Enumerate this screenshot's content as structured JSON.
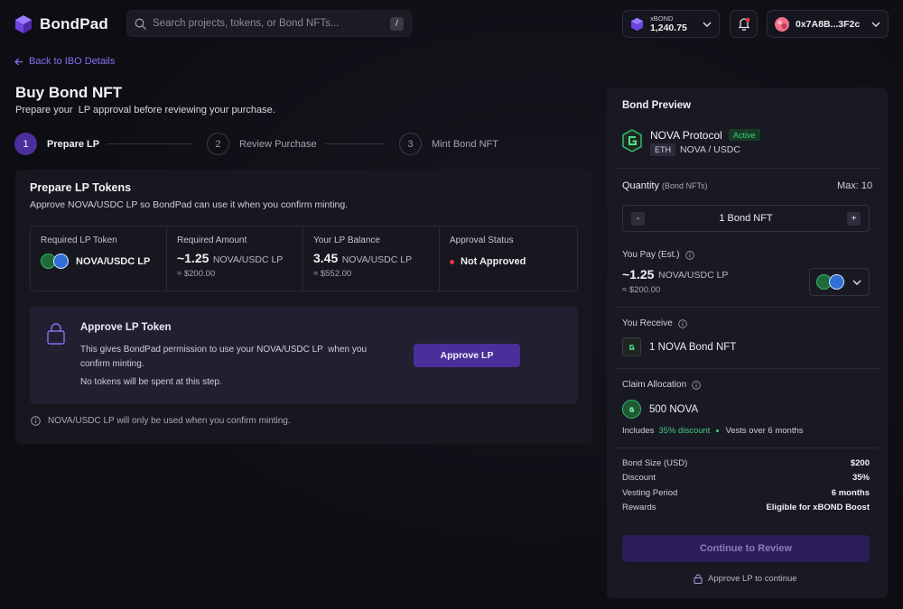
{
  "app": {
    "name": "BondPad"
  },
  "search": {
    "placeholder": "Search projects, tokens, or Bond NFTs...",
    "shortcut": "/"
  },
  "xbond": {
    "label": "xBOND",
    "value": "1,240.75"
  },
  "wallet": {
    "address": "0x7A8B...3F2c"
  },
  "nav": {
    "back_label": "Back to IBO Details"
  },
  "page": {
    "title": "Buy Bond NFT",
    "subtitle": "Prepare your  LP approval before reviewing your purchase."
  },
  "steps": [
    {
      "number": "1",
      "label": "Prepare LP",
      "active": true
    },
    {
      "number": "2",
      "label": "Review Purchase",
      "active": false
    },
    {
      "number": "3",
      "label": "Mint Bond NFT",
      "active": false
    }
  ],
  "prepare": {
    "title": "Prepare LP Tokens",
    "subtitle": "Approve NOVA/USDC LP so BondPad can use it when you confirm minting.",
    "required_token": {
      "label": "Required LP Token",
      "value": "NOVA/USDC LP"
    },
    "required_amount": {
      "label": "Required Amount",
      "value": "~1.25",
      "unit": "NOVA/USDC LP",
      "usd": "≈ $200.00"
    },
    "balance": {
      "label": "Your LP Balance",
      "value": "3.45",
      "unit": "NOVA/USDC LP",
      "usd": "≈ $552.00"
    },
    "approval": {
      "label": "Approval Status",
      "value": "Not Approved",
      "status_color": "#e03a3a"
    }
  },
  "approve_box": {
    "title": "Approve LP Token",
    "description": "This gives BondPad permission to use your NOVA/USDC LP  when you confirm minting.",
    "note": "No tokens will be spent at this step.",
    "button_label": "Approve LP"
  },
  "lp_note": "NOVA/USDC LP will only be used when you confirm minting.",
  "preview": {
    "title": "Bond Preview",
    "protocol": "NOVA Protocol",
    "status": "Active",
    "chain": "ETH",
    "pair": "NOVA / USDC",
    "quantity_label": "Quantity",
    "quantity_sub": "(Bond NFTs)",
    "max": "Max: 10",
    "quantity_value": "1 Bond NFT",
    "minus": "-",
    "plus": "+",
    "pay_label": "You Pay (Est.)",
    "pay_amount": "~1.25",
    "pay_unit": "NOVA/USDC LP",
    "pay_usd": "≈ $200.00",
    "receive_label": "You Receive",
    "receive_value": "1 NOVA Bond NFT",
    "claim_label": "Claim Allocation",
    "claim_value": "500 NOVA",
    "claim_includes": "Includes",
    "claim_discount": "35% discount",
    "claim_vest": "Vests over 6 months",
    "summary": [
      {
        "k": "Bond Size (USD)",
        "v": "$200"
      },
      {
        "k": "Discount",
        "v": "35%"
      },
      {
        "k": "Vesting Period",
        "v": "6 months"
      },
      {
        "k": "Rewards",
        "v": "Eligible for xBOND Boost"
      }
    ],
    "continue_label": "Continue to Review",
    "lock_note": "Approve LP to continue"
  },
  "colors": {
    "accent": "#4a2f9a",
    "link": "#8c6cf0",
    "success": "#3fcf7c",
    "danger": "#e03a3a"
  }
}
